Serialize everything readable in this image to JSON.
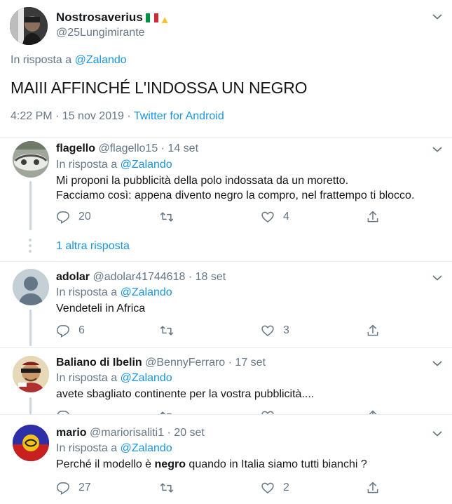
{
  "main": {
    "name": "Nostrosaverius",
    "handle": "@25Lungimirante",
    "reply_prefix": "In risposta a",
    "reply_to": "@Zalando",
    "text": "MAIII AFFINCHÉ L'INDOSSA UN NEGRO",
    "timestamp": "4:22 PM · 15 nov 2019 ·",
    "source": "Twitter for Android"
  },
  "replies": [
    {
      "name": "flagello",
      "handle": "@flagello15 · 14 set",
      "reply_prefix": "In risposta a",
      "reply_to": "@Zalando",
      "line1": "Mi proponi la pubblicità della polo indossata da un moretto.",
      "line2": "Facciamo così: appena divento  negro la compro, nel frattempo ti blocco.",
      "reply_count": "20",
      "like_count": "4",
      "more_replies": "1 altra risposta"
    },
    {
      "name": "adolar",
      "handle": "@adolar41744618 · 18 set",
      "reply_prefix": "In risposta a",
      "reply_to": "@Zalando",
      "line1": "Vendeteli  in Africa",
      "reply_count": "6",
      "like_count": "3"
    },
    {
      "name": "Baliano di Ibelin",
      "handle": "@BennyFerraro · 17 set",
      "reply_prefix": "In risposta a",
      "reply_to": "@Zalando",
      "line1": "avete sbagliato continente per la vostra pubblicità...."
    },
    {
      "name": "mario",
      "handle": "@mariorisaliti1 · 20 set",
      "reply_prefix": "In risposta a",
      "reply_to": "@Zalando",
      "line1_a": "Perché il modello è ",
      "line1_b": "negro",
      "line1_c": " quando in Italia siamo tutti bianchi ?",
      "reply_count": "27",
      "like_count": "2"
    }
  ],
  "colors": {
    "text": "#14171a",
    "secondary": "#657786",
    "link": "#1b95e0",
    "divider": "#e6ecf0"
  },
  "icons": [
    "chevron-down-icon",
    "reply-icon",
    "retweet-icon",
    "like-icon",
    "share-icon",
    "italy-flag-icon",
    "thumbs-up-icon"
  ]
}
